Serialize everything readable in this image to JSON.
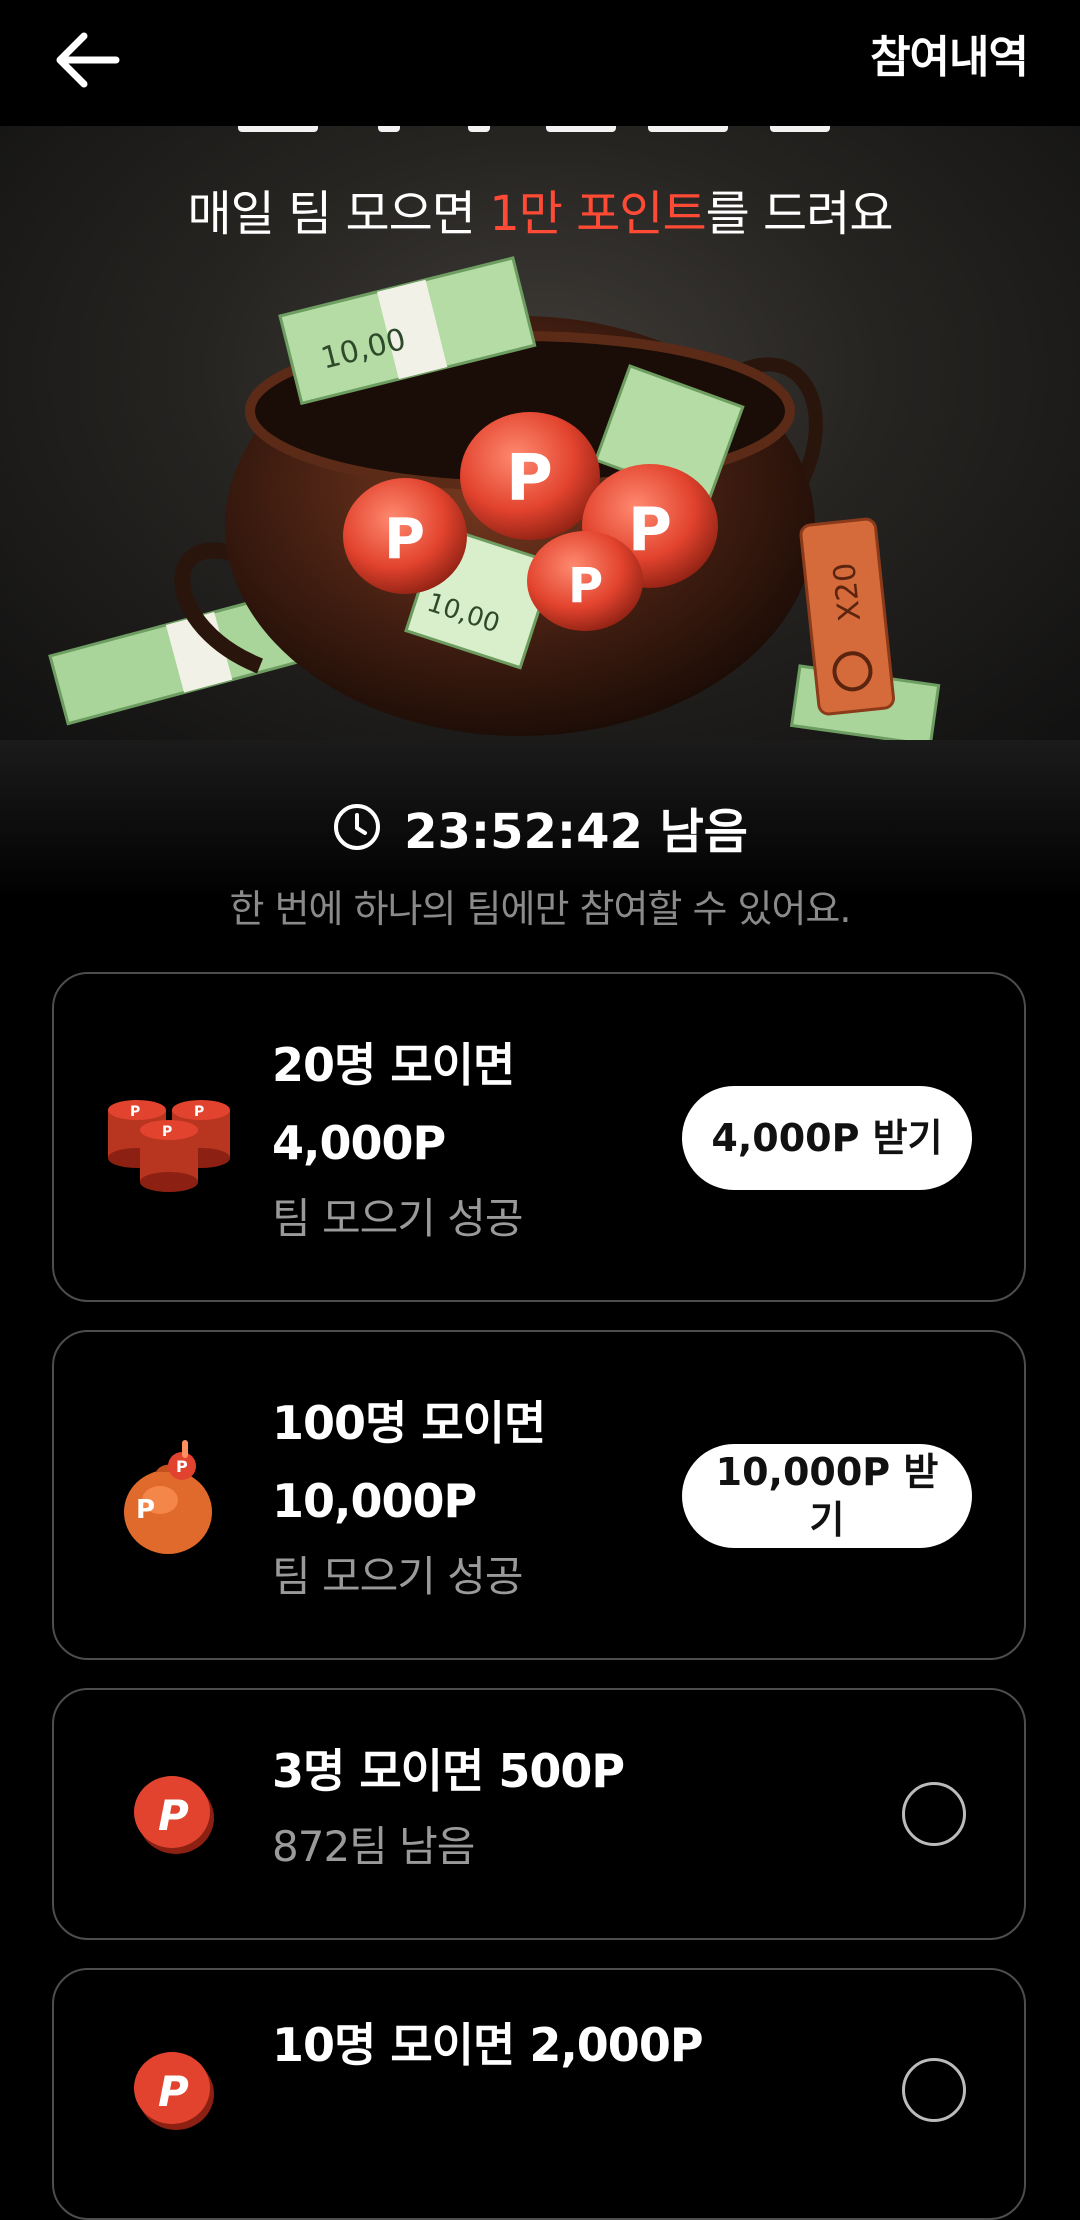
{
  "header": {
    "back_icon": "arrow-left-icon",
    "history_label": "참여내역"
  },
  "hero": {
    "subtitle_before": "매일 팀 모으면 ",
    "subtitle_highlight": "1만 포인트",
    "subtitle_after": "를 드려요",
    "highlight_color": "#ff4a35",
    "illustration": "pot-of-points-icon",
    "tag_text": "X20"
  },
  "timer": {
    "icon": "clock-icon",
    "text": "23:52:42 남음"
  },
  "notice": "한 번에 하나의 팀에만 참여할 수 있어요.",
  "cards": [
    {
      "title": "20명 모이면",
      "amount": "4,000P",
      "status": "팀 모으기 성공",
      "button": "4,000P 받기",
      "icon": "coin-stack-icon"
    },
    {
      "title": "100명 모이면",
      "amount": "10,000P",
      "status": "팀 모으기 성공",
      "button": "10,000P 받기",
      "icon": "point-bag-icon"
    },
    {
      "title": "3명 모이면 500P",
      "status": "872팀 남음",
      "icon": "point-coin-icon"
    },
    {
      "title": "10명 모이면 2,000P",
      "icon": "point-coin-icon"
    }
  ]
}
